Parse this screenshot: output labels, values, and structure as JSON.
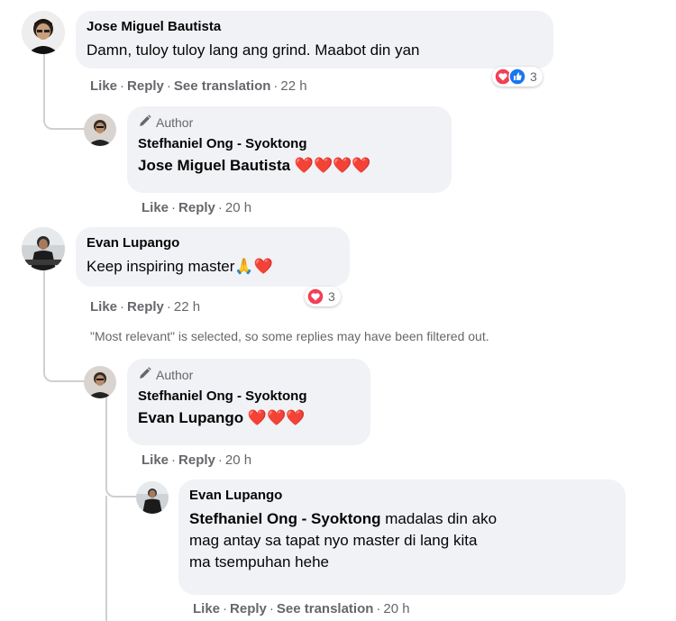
{
  "comments": [
    {
      "id": "c1",
      "author": "Jose Miguel Bautista",
      "text": "Damn, tuloy tuloy lang ang grind. Maabot din yan",
      "actions": {
        "like": "Like",
        "reply": "Reply",
        "translate": "See translation",
        "time": "22 h"
      },
      "reactions": {
        "icons": [
          "love",
          "like"
        ],
        "count": "3"
      }
    },
    {
      "id": "c1r1",
      "author_badge": "Author",
      "author": "Stefhaniel Ong - Syoktong",
      "mention": "Jose Miguel Bautista",
      "hearts": "❤️❤️❤️❤️",
      "actions": {
        "like": "Like",
        "reply": "Reply",
        "time": "20 h"
      }
    },
    {
      "id": "c2",
      "author": "Evan Lupango",
      "text": "Keep inspiring master",
      "emoji": "🙏❤️",
      "actions": {
        "like": "Like",
        "reply": "Reply",
        "time": "22 h"
      },
      "reactions": {
        "icons": [
          "love"
        ],
        "count": "3"
      }
    },
    {
      "id": "c2r1",
      "author_badge": "Author",
      "author": "Stefhaniel Ong - Syoktong",
      "mention": "Evan Lupango",
      "hearts": "❤️❤️❤️",
      "actions": {
        "like": "Like",
        "reply": "Reply",
        "time": "20 h"
      }
    },
    {
      "id": "c2r2",
      "author": "Evan Lupango",
      "mention": "Stefhaniel Ong - Syoktong",
      "text_line1": "madalas din ako",
      "text_line2": "mag antay sa tapat nyo master di lang kita",
      "text_line3": "ma tsempuhan hehe",
      "actions": {
        "like": "Like",
        "reply": "Reply",
        "translate": "See translation",
        "time": "20 h"
      }
    }
  ],
  "filter_notice": "\"Most relevant\" is selected, so some replies may have been filtered out.",
  "separator": "·",
  "colors": {
    "bubble": "#f0f2f5",
    "meta": "#65676b",
    "love": "#f33e58",
    "like": "#1877f2",
    "line": "#ced0d4"
  }
}
